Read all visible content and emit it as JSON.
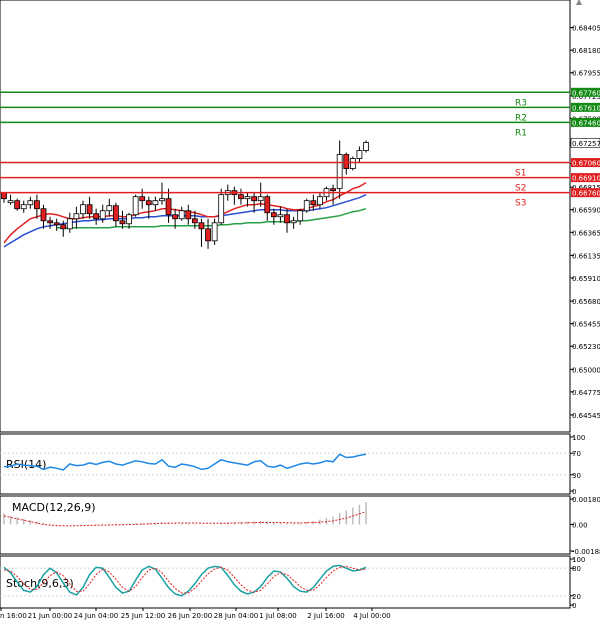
{
  "chart_data": {
    "type": "candlestick",
    "main": {
      "ylim": [
        0.64435,
        0.6862
      ],
      "y_ticks": [
        "0.68405",
        "0.68180",
        "0.67955",
        "0.67725",
        "0.67500",
        "0.67257",
        "0.67050",
        "0.66815",
        "0.66590",
        "0.66365",
        "0.66135",
        "0.65910",
        "0.65680",
        "0.65455",
        "0.65230",
        "0.65000",
        "0.64775",
        "0.64545"
      ],
      "last_price": "0.67257",
      "levels": [
        {
          "name": "R3",
          "value": 0.6776,
          "label": "0.67760",
          "color": "#138a13"
        },
        {
          "name": "R2",
          "value": 0.6761,
          "label": "0.67610",
          "color": "#138a13"
        },
        {
          "name": "R1",
          "value": 0.6746,
          "label": "0.67460",
          "color": "#138a13"
        },
        {
          "name": "S1",
          "value": 0.6706,
          "label": "0.67060",
          "color": "#e02020"
        },
        {
          "name": "S2",
          "value": 0.6691,
          "label": "0.66910",
          "color": "#e02020"
        },
        {
          "name": "S3",
          "value": 0.6676,
          "label": "0.66760",
          "color": "#e02020"
        }
      ],
      "candles": [
        [
          0.6676,
          0.6673,
          0.667,
          0.6666
        ],
        [
          0.6666,
          0.6674,
          0.6668,
          0.6664
        ],
        [
          0.6668,
          0.667,
          0.666,
          0.6658
        ],
        [
          0.666,
          0.6668,
          0.6664,
          0.6656
        ],
        [
          0.6664,
          0.6672,
          0.6668,
          0.666
        ],
        [
          0.6668,
          0.6674,
          0.666,
          0.665
        ],
        [
          0.666,
          0.6664,
          0.6648,
          0.664
        ],
        [
          0.6648,
          0.6652,
          0.6646,
          0.664
        ],
        [
          0.6646,
          0.665,
          0.6644,
          0.6638
        ],
        [
          0.6644,
          0.6648,
          0.664,
          0.6632
        ],
        [
          0.664,
          0.6656,
          0.665,
          0.6636
        ],
        [
          0.665,
          0.6662,
          0.6655,
          0.664
        ],
        [
          0.6655,
          0.6668,
          0.6664,
          0.665
        ],
        [
          0.6664,
          0.6672,
          0.6655,
          0.665
        ],
        [
          0.6655,
          0.666,
          0.665,
          0.6644
        ],
        [
          0.665,
          0.6664,
          0.6658,
          0.6646
        ],
        [
          0.6658,
          0.667,
          0.6663,
          0.6652
        ],
        [
          0.6663,
          0.6666,
          0.6648,
          0.6642
        ],
        [
          0.6648,
          0.6658,
          0.6645,
          0.664
        ],
        [
          0.6645,
          0.6656,
          0.6654,
          0.664
        ],
        [
          0.6654,
          0.6674,
          0.6672,
          0.6652
        ],
        [
          0.6672,
          0.668,
          0.6668,
          0.666
        ],
        [
          0.6668,
          0.6672,
          0.6664,
          0.665
        ],
        [
          0.6664,
          0.6672,
          0.6668,
          0.6658
        ],
        [
          0.6668,
          0.6686,
          0.667,
          0.6664
        ],
        [
          0.667,
          0.668,
          0.6654,
          0.6646
        ],
        [
          0.6654,
          0.666,
          0.665,
          0.664
        ],
        [
          0.665,
          0.6662,
          0.6658,
          0.6648
        ],
        [
          0.6658,
          0.6664,
          0.665,
          0.6644
        ],
        [
          0.665,
          0.6658,
          0.6646,
          0.664
        ],
        [
          0.6646,
          0.665,
          0.664,
          0.6622
        ],
        [
          0.664,
          0.665,
          0.6628,
          0.662
        ],
        [
          0.6628,
          0.665,
          0.6646,
          0.6624
        ],
        [
          0.6646,
          0.668,
          0.6674,
          0.6644
        ],
        [
          0.6674,
          0.6684,
          0.6678,
          0.6668
        ],
        [
          0.6678,
          0.6682,
          0.6674,
          0.6664
        ],
        [
          0.6674,
          0.668,
          0.667,
          0.6664
        ],
        [
          0.667,
          0.6676,
          0.6672,
          0.6662
        ],
        [
          0.6672,
          0.6676,
          0.6668,
          0.6656
        ],
        [
          0.6668,
          0.6686,
          0.6672,
          0.6662
        ],
        [
          0.6672,
          0.6674,
          0.6656,
          0.6648
        ],
        [
          0.6656,
          0.666,
          0.6652,
          0.6644
        ],
        [
          0.6652,
          0.6662,
          0.6654,
          0.6646
        ],
        [
          0.6654,
          0.666,
          0.6646,
          0.6636
        ],
        [
          0.6646,
          0.6652,
          0.6648,
          0.664
        ],
        [
          0.6648,
          0.666,
          0.6658,
          0.6644
        ],
        [
          0.6658,
          0.667,
          0.6668,
          0.6656
        ],
        [
          0.6668,
          0.6674,
          0.6664,
          0.6658
        ],
        [
          0.6664,
          0.6676,
          0.6672,
          0.666
        ],
        [
          0.6672,
          0.6682,
          0.668,
          0.6668
        ],
        [
          0.668,
          0.6684,
          0.6678,
          0.6664
        ],
        [
          0.668,
          0.6728,
          0.6714,
          0.667
        ],
        [
          0.6714,
          0.6716,
          0.67,
          0.6694
        ],
        [
          0.67,
          0.6712,
          0.671,
          0.6698
        ],
        [
          0.671,
          0.6722,
          0.6718,
          0.6706
        ],
        [
          0.6718,
          0.6728,
          0.6726,
          0.6716
        ]
      ],
      "ma_red": [
        0.6626,
        0.6634,
        0.664,
        0.6645,
        0.665,
        0.6652,
        0.6654,
        0.6655,
        0.6654,
        0.6652,
        0.665,
        0.665,
        0.6651,
        0.6652,
        0.6652,
        0.6652,
        0.6653,
        0.6653,
        0.6652,
        0.6652,
        0.6654,
        0.6656,
        0.6657,
        0.6658,
        0.666,
        0.666,
        0.6659,
        0.6658,
        0.6657,
        0.6656,
        0.6654,
        0.6652,
        0.6652,
        0.6654,
        0.6657,
        0.666,
        0.6662,
        0.6664,
        0.6664,
        0.6665,
        0.6664,
        0.6663,
        0.6662,
        0.666,
        0.6659,
        0.6659,
        0.666,
        0.6662,
        0.6664,
        0.6667,
        0.6669,
        0.6673,
        0.6676,
        0.668,
        0.6682,
        0.6686
      ],
      "ma_blue": [
        0.6622,
        0.6626,
        0.663,
        0.6634,
        0.6637,
        0.664,
        0.6642,
        0.6643,
        0.6644,
        0.6645,
        0.6646,
        0.6647,
        0.6648,
        0.6648,
        0.6649,
        0.6649,
        0.665,
        0.665,
        0.665,
        0.665,
        0.6651,
        0.6651,
        0.6652,
        0.6652,
        0.6653,
        0.6653,
        0.6653,
        0.6653,
        0.6653,
        0.6653,
        0.6652,
        0.6652,
        0.6652,
        0.6653,
        0.6654,
        0.6655,
        0.6656,
        0.6657,
        0.6658,
        0.6659,
        0.6659,
        0.6659,
        0.6659,
        0.6658,
        0.6658,
        0.6658,
        0.6658,
        0.6659,
        0.666,
        0.6661,
        0.6663,
        0.6665,
        0.6667,
        0.6669,
        0.6671,
        0.6674
      ],
      "ma_green": [
        null,
        null,
        null,
        null,
        null,
        null,
        null,
        null,
        0.6641,
        0.6641,
        0.6641,
        0.6641,
        0.6641,
        0.6641,
        0.6641,
        0.6641,
        0.6641,
        0.6642,
        0.6642,
        0.6642,
        0.6642,
        0.6642,
        0.6642,
        0.6642,
        0.6643,
        0.6643,
        0.6643,
        0.6643,
        0.6643,
        0.6643,
        0.6643,
        0.6643,
        0.6643,
        0.6644,
        0.6644,
        0.6645,
        0.6645,
        0.6646,
        0.6646,
        0.6646,
        0.6647,
        0.6647,
        0.6647,
        0.6647,
        0.6647,
        0.6648,
        0.6648,
        0.6649,
        0.665,
        0.6651,
        0.6652,
        0.6653,
        0.6655,
        0.6657,
        0.6658,
        0.666
      ]
    },
    "rsi": {
      "label": "RSI(14)",
      "ticks": [
        "100",
        "70",
        "30",
        "0"
      ],
      "ylim": [
        0,
        100
      ],
      "values": [
        45,
        46,
        50,
        48,
        47,
        46,
        40,
        44,
        42,
        39,
        50,
        47,
        48,
        52,
        49,
        53,
        55,
        50,
        48,
        52,
        56,
        54,
        51,
        50,
        58,
        46,
        44,
        50,
        48,
        45,
        40,
        42,
        50,
        58,
        54,
        52,
        50,
        48,
        54,
        56,
        46,
        44,
        48,
        42,
        46,
        50,
        52,
        50,
        52,
        56,
        54,
        68,
        62,
        63,
        66,
        68
      ]
    },
    "macd": {
      "label": "MACD(12,26,9)",
      "ticks": [
        "0.001805",
        "0.00",
        "-0.001886"
      ],
      "ylim": [
        -0.001886,
        0.001805
      ],
      "histogram": [
        0.0008,
        0.0006,
        0.0005,
        0.0004,
        0.0003,
        0.0002,
        0.0001,
        5e-05,
        2e-05,
        0.0,
        0.0,
        0.0,
        2e-05,
        3e-05,
        3e-05,
        4e-05,
        5e-05,
        6e-05,
        5e-05,
        6e-05,
        8e-05,
        0.0001,
        0.00012,
        0.00014,
        0.00016,
        0.00014,
        0.00012,
        0.0001,
        8e-05,
        5e-05,
        2e-05,
        0.0,
        2e-05,
        8e-05,
        0.00012,
        0.00015,
        0.00018,
        0.0002,
        0.00022,
        0.00025,
        0.00022,
        0.00018,
        0.00015,
        0.0001,
        0.0001,
        0.00012,
        0.00018,
        0.00025,
        0.00035,
        0.00045,
        0.00055,
        0.0008,
        0.001,
        0.0012,
        0.0014,
        0.0016
      ],
      "signal": [
        0.0006,
        0.0005,
        0.0004,
        0.0003,
        0.0002,
        0.0001,
        0.0,
        -5e-05,
        -8e-05,
        -0.0001,
        -0.0001,
        -9e-05,
        -8e-05,
        -7e-05,
        -6e-05,
        -5e-05,
        -4e-05,
        -3e-05,
        -2e-05,
        -1e-05,
        0.0,
        2e-05,
        4e-05,
        6e-05,
        8e-05,
        9e-05,
        0.0001,
        0.0001,
        0.0001,
        0.0001,
        9e-05,
        8e-05,
        8e-05,
        8e-05,
        9e-05,
        0.0001,
        0.00011,
        0.00012,
        0.00013,
        0.00014,
        0.00014,
        0.00014,
        0.00013,
        0.00012,
        0.00011,
        0.00011,
        0.00012,
        0.00014,
        0.00016,
        0.0002,
        0.00025,
        0.00035,
        0.00045,
        0.0006,
        0.00075,
        0.0009
      ]
    },
    "stoch": {
      "label": "Stoch(9,6,3)",
      "ticks": [
        "100",
        "80",
        "20",
        "0"
      ],
      "ylim": [
        0,
        100
      ],
      "k": [
        82,
        70,
        50,
        32,
        28,
        40,
        66,
        80,
        70,
        48,
        28,
        22,
        38,
        66,
        82,
        80,
        60,
        38,
        26,
        30,
        54,
        76,
        84,
        78,
        58,
        38,
        24,
        20,
        30,
        46,
        66,
        80,
        84,
        82,
        64,
        44,
        30,
        24,
        28,
        40,
        60,
        74,
        72,
        58,
        40,
        30,
        28,
        38,
        56,
        74,
        84,
        86,
        80,
        74,
        76,
        82
      ],
      "d": [
        76,
        74,
        62,
        46,
        34,
        34,
        48,
        64,
        72,
        64,
        46,
        30,
        30,
        46,
        66,
        78,
        72,
        56,
        38,
        30,
        40,
        60,
        76,
        80,
        70,
        52,
        36,
        26,
        26,
        36,
        52,
        68,
        78,
        82,
        76,
        60,
        44,
        32,
        28,
        32,
        46,
        62,
        70,
        66,
        54,
        40,
        32,
        32,
        44,
        60,
        74,
        82,
        84,
        80,
        76,
        78
      ]
    },
    "x_labels": [
      "n 16:00",
      "21 Jun 00:00",
      "24 Jun 04:00",
      "25 Jun 12:00",
      "26 Jun 20:00",
      "28 Jun 04:00",
      "1 Jul 08:00",
      "2 Jul 16:00",
      "4 Jul 00:00"
    ],
    "colors": {
      "bull": "#138a13",
      "bear": "#e02020",
      "ma_red": "#e02020",
      "ma_blue": "#2a4fd0",
      "ma_green": "#27a045",
      "rsi": "#1e88e5",
      "macd": "#e02020",
      "stoch_k": "#1aa0a0",
      "stoch_d": "#e02020",
      "grid": "#d0d0d0"
    }
  }
}
